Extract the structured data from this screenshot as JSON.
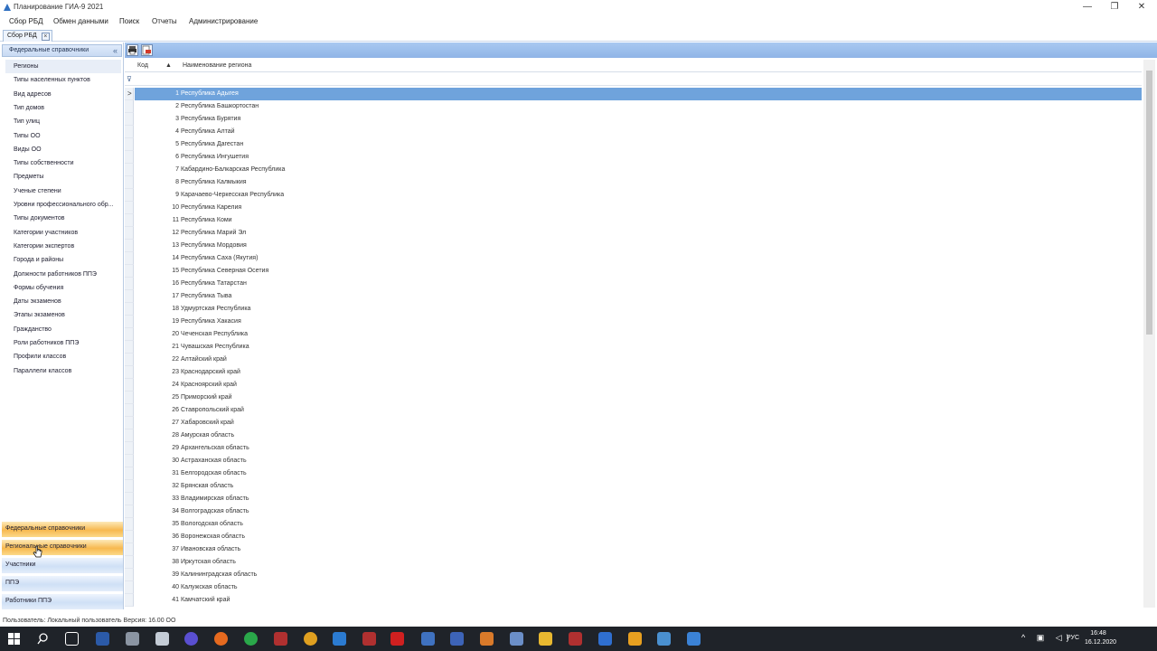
{
  "window": {
    "title": "Планирование ГИА-9 2021",
    "minimize": "—",
    "maximize": "❐",
    "close": "✕"
  },
  "menu": [
    "Сбор РБД",
    "Обмен данными",
    "Поиск",
    "Отчеты",
    "Администрирование"
  ],
  "doc_tab": {
    "label": "Сбор РБД",
    "close": "×"
  },
  "left_pane": {
    "header": "Федеральные справочники",
    "collapse": "«",
    "items": [
      "Регионы",
      "Типы населенных пунктов",
      "Вид адресов",
      "Тип домов",
      "Тип улиц",
      "Типы ОО",
      "Виды ОО",
      "Типы собственности",
      "Предметы",
      "Ученые степени",
      "Уровни профессионального обр...",
      "Типы документов",
      "Категории участников",
      "Категории экспертов",
      "Города и районы",
      "Должности работников ППЭ",
      "Формы обучения",
      "Даты экзаменов",
      "Этапы экзаменов",
      "Гражданство",
      "Роли работников ППЭ",
      "Профили классов",
      "Параллели классов"
    ],
    "nav_buttons": [
      "Федеральные справочники",
      "Региональные справочники",
      "Участники",
      "ППЭ",
      "Работники ППЭ"
    ]
  },
  "grid": {
    "columns": {
      "code": "Код",
      "sort": "▲",
      "name": "Наименование региона"
    },
    "filter_icon": "⊽",
    "current_row_marker": ">",
    "rows": [
      [
        "1",
        "Республика Адыгея"
      ],
      [
        "2",
        "Республика Башкортостан"
      ],
      [
        "3",
        "Республика Бурятия"
      ],
      [
        "4",
        "Республика Алтай"
      ],
      [
        "5",
        "Республика Дагестан"
      ],
      [
        "6",
        "Республика Ингушетия"
      ],
      [
        "7",
        "Кабардино-Балкарская Республика"
      ],
      [
        "8",
        "Республика Калмыкия"
      ],
      [
        "9",
        "Карачаево-Черкесская Республика"
      ],
      [
        "10",
        "Республика Карелия"
      ],
      [
        "11",
        "Республика Коми"
      ],
      [
        "12",
        "Республика Марий Эл"
      ],
      [
        "13",
        "Республика Мордовия"
      ],
      [
        "14",
        "Республика Саха (Якутия)"
      ],
      [
        "15",
        "Республика Северная Осетия"
      ],
      [
        "16",
        "Республика Татарстан"
      ],
      [
        "17",
        "Республика Тыва"
      ],
      [
        "18",
        "Удмуртская Республика"
      ],
      [
        "19",
        "Республика Хакасия"
      ],
      [
        "20",
        "Чеченская Республика"
      ],
      [
        "21",
        "Чувашская Республика"
      ],
      [
        "22",
        "Алтайский край"
      ],
      [
        "23",
        "Краснодарский край"
      ],
      [
        "24",
        "Красноярский край"
      ],
      [
        "25",
        "Приморский край"
      ],
      [
        "26",
        "Ставропольский край"
      ],
      [
        "27",
        "Хабаровский край"
      ],
      [
        "28",
        "Амурская область"
      ],
      [
        "29",
        "Архангельская область"
      ],
      [
        "30",
        "Астраханская область"
      ],
      [
        "31",
        "Белгородская область"
      ],
      [
        "32",
        "Брянская область"
      ],
      [
        "33",
        "Владимирская область"
      ],
      [
        "34",
        "Волгоградская область"
      ],
      [
        "35",
        "Вологодская область"
      ],
      [
        "36",
        "Воронежская область"
      ],
      [
        "37",
        "Ивановская область"
      ],
      [
        "38",
        "Иркутская область"
      ],
      [
        "39",
        "Калининградская область"
      ],
      [
        "40",
        "Калужская область"
      ],
      [
        "41",
        "Камчатский край"
      ]
    ]
  },
  "status": "Пользователь: Локальный пользователь  Версия: 16.00  ОО",
  "taskbar": {
    "lang": "РУС",
    "time": "16:48",
    "date": "16.12.2020",
    "tray": "^ ▣ ◁) "
  },
  "colors": {
    "accent": "#6fa3dc",
    "toolbar": "#9cbdeb",
    "nav_active": "#f7b94f",
    "taskbar": "#1f2329"
  }
}
